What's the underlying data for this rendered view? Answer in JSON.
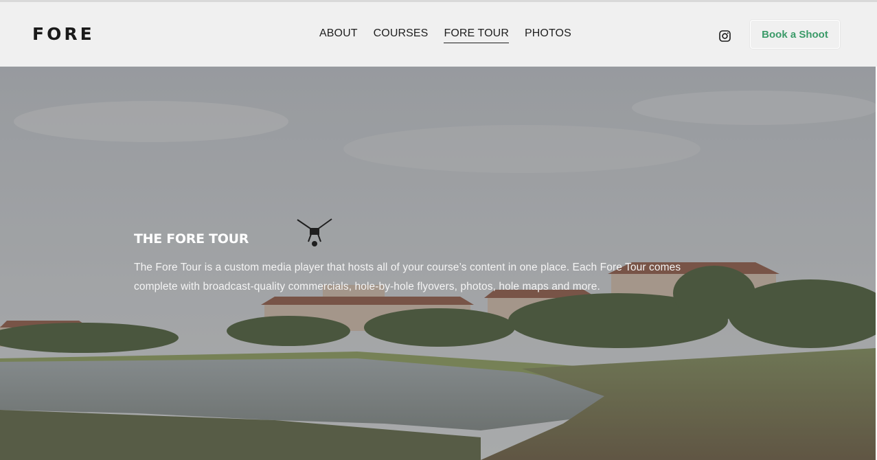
{
  "site": {
    "logo": "FORE"
  },
  "nav": {
    "items": [
      {
        "label": "ABOUT",
        "active": false
      },
      {
        "label": "COURSES",
        "active": false
      },
      {
        "label": "FORE TOUR",
        "active": true
      },
      {
        "label": "PHOTOS",
        "active": false
      }
    ]
  },
  "header": {
    "social_icon": "instagram-icon",
    "cta_label": "Book a Shoot",
    "cta_color": "#3a9a68"
  },
  "hero": {
    "title": "THE FORE TOUR",
    "description": "The Fore Tour is a custom media player that hosts all of your course’s content in one place. Each Fore Tour comes complete with broadcast-quality commercials, hole-by-hole flyovers, photos, hole maps and more.",
    "background": "golf-course-drone-photo"
  }
}
